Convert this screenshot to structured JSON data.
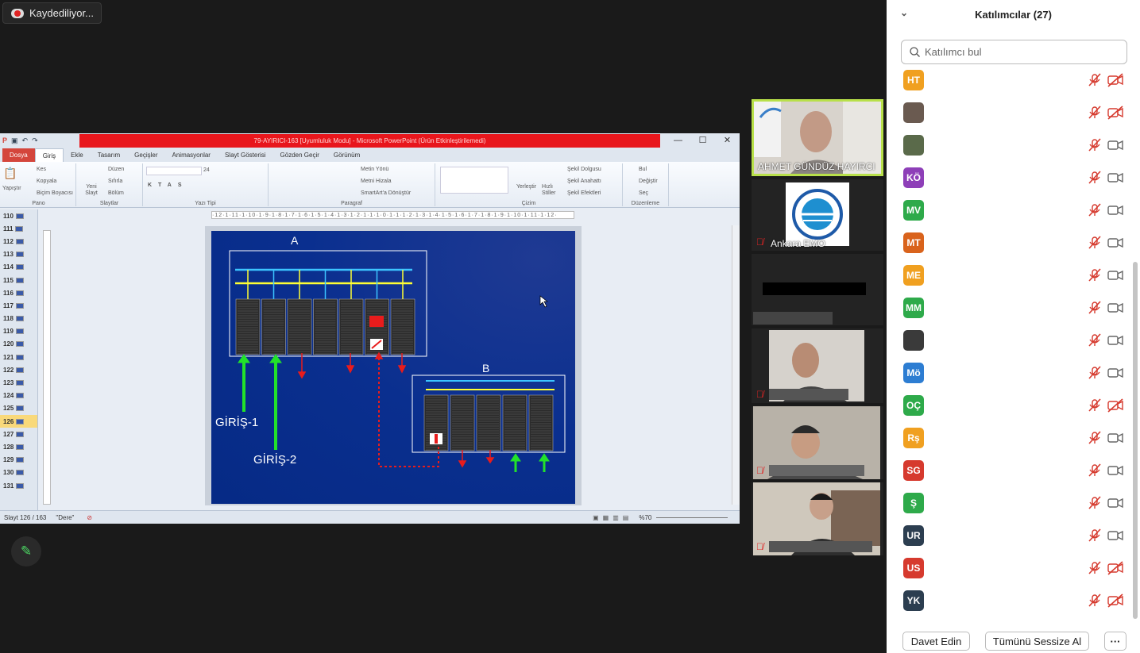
{
  "recording": {
    "label": "Kaydediliyor..."
  },
  "ppt": {
    "red_title": "79-AYIRICI-163 [Uyumluluk Modu] - Microsoft PowerPoint (Ürün Etkinleştirilemedi)",
    "tabs": [
      "Dosya",
      "Giriş",
      "Ekle",
      "Tasarım",
      "Geçişler",
      "Animasyonlar",
      "Slayt Gösterisi",
      "Gözden Geçir",
      "Görünüm"
    ],
    "groups": {
      "pano": "Pano",
      "slaytlar": "Slaytlar",
      "yazi_tipi": "Yazı Tipi",
      "paragraf": "Paragraf",
      "cizim": "Çizim",
      "duzenleme": "Düzenleme"
    },
    "pano_items": {
      "paste": "Yapıştır",
      "cut": "Kes",
      "copy": "Kopyala",
      "format": "Biçim Boyacısı"
    },
    "slayt_items": {
      "new": "Yeni Slayt",
      "layout": "Düzen",
      "reset": "Sıfırla",
      "section": "Bölüm"
    },
    "font_size": "24",
    "para_items": {
      "dir": "Metin Yönü",
      "align": "Metni Hizala",
      "smartart": "SmartArt'a Dönüştür"
    },
    "draw_items": {
      "arrange": "Yerleştir",
      "quick": "Hızlı Stiller",
      "fill": "Şekil Dolgusu",
      "outline": "Şekil Anahattı",
      "effects": "Şekil Efektleri"
    },
    "edit_items": {
      "find": "Bul",
      "replace": "Değiştir",
      "select": "Seç"
    },
    "ruler": "·12·1·11·1·10·1·9·1·8·1·7·1·6·1·5·1·4·1·3·1·2·1·1·1·0·1·1·1·2·1·3·1·4·1·5·1·6·1·7·1·8·1·9·1·10·1·11·1·12·",
    "slides": [
      "110",
      "111",
      "112",
      "113",
      "114",
      "115",
      "116",
      "117",
      "118",
      "119",
      "120",
      "121",
      "122",
      "123",
      "124",
      "125",
      "126",
      "127",
      "128",
      "129",
      "130",
      "131"
    ],
    "selected_slide": "126",
    "slide_text": {
      "a": "A",
      "b": "B",
      "in1": "GİRİŞ-1",
      "in2": "GİRİŞ-2"
    },
    "status": {
      "slide": "Slayt 126 / 163",
      "theme": "\"Dere\"",
      "zoom": "%70"
    }
  },
  "videos": [
    {
      "name": "AHMET GÜNDÜZ HAYIRCI"
    },
    {
      "name": "Ankara EMO"
    }
  ],
  "participants": {
    "title": "Katılımcılar (27)",
    "search_placeholder": "Katılımcı bul",
    "list": [
      {
        "initials": "HT",
        "color": "#f0a020",
        "video_off": true
      },
      {
        "initials": "",
        "color": "#6a5a50",
        "video_off": true
      },
      {
        "initials": "",
        "color": "#5a6a4a",
        "video_off": false
      },
      {
        "initials": "KÖ",
        "color": "#8e3fb8",
        "video_off": false
      },
      {
        "initials": "MV",
        "color": "#2eaa4a",
        "video_off": false
      },
      {
        "initials": "MT",
        "color": "#d9631c",
        "video_off": false
      },
      {
        "initials": "ME",
        "color": "#f0a020",
        "video_off": false
      },
      {
        "initials": "MM",
        "color": "#2eaa4a",
        "video_off": false
      },
      {
        "initials": "",
        "color": "#3a3a3a",
        "video_off": false
      },
      {
        "initials": "Mö",
        "color": "#2d7dd2",
        "video_off": false
      },
      {
        "initials": "OÇ",
        "color": "#2eaa4a",
        "video_off": true
      },
      {
        "initials": "Rş",
        "color": "#f0a020",
        "video_off": false
      },
      {
        "initials": "SG",
        "color": "#d63a2e",
        "video_off": false
      },
      {
        "initials": "Ş",
        "color": "#2eaa4a",
        "video_off": false
      },
      {
        "initials": "UR",
        "color": "#2c3e50",
        "video_off": false
      },
      {
        "initials": "US",
        "color": "#d63a2e",
        "video_off": true
      },
      {
        "initials": "YK",
        "color": "#2c3e50",
        "video_off": true
      }
    ],
    "invite": "Davet Edin",
    "mute_all": "Tümünü Sessize Al",
    "more": "···"
  }
}
